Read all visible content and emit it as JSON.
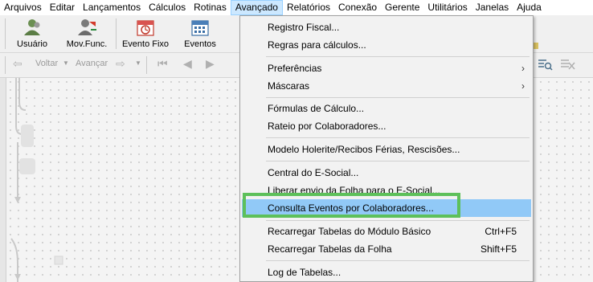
{
  "menubar": {
    "items": [
      "Arquivos",
      "Editar",
      "Lançamentos",
      "Cálculos",
      "Rotinas",
      "Avançado",
      "Relatórios",
      "Conexão",
      "Gerente",
      "Utilitários",
      "Janelas",
      "Ajuda"
    ]
  },
  "toolbar": {
    "buttons": [
      {
        "label": "Usuário",
        "icon": "users-icon"
      },
      {
        "label": "Mov.Func.",
        "icon": "employee-movement-icon"
      },
      {
        "label": "Evento Fixo",
        "icon": "fixed-event-calendar-icon"
      },
      {
        "label": "Eventos",
        "icon": "events-calendar-icon"
      }
    ]
  },
  "navbar": {
    "back_label": "Voltar",
    "forward_label": "Avançar"
  },
  "dropdown": {
    "items": [
      {
        "label": "Registro Fiscal..."
      },
      {
        "label": "Regras para cálculos..."
      },
      {
        "label": "Preferências",
        "submenu": true
      },
      {
        "label": "Máscaras",
        "submenu": true
      },
      {
        "label": "Fórmulas de Cálculo..."
      },
      {
        "label": "Rateio por Colaboradores..."
      },
      {
        "label": "Modelo Holerite/Recibos Férias, Rescisões..."
      },
      {
        "label": "Central do E-Social..."
      },
      {
        "label": "Liberar envio da Folha para o E-Social..."
      },
      {
        "label": "Consulta Eventos por Colaboradores...",
        "highlighted": true
      },
      {
        "label": "Recarregar Tabelas do Módulo Básico",
        "shortcut": "Ctrl+F5"
      },
      {
        "label": "Recarregar Tabelas da Folha",
        "shortcut": "Shift+F5"
      },
      {
        "label": "Log de Tabelas..."
      }
    ]
  },
  "colors": {
    "highlight_item": "#91c9f7",
    "callout_border": "#5dc05a",
    "active_menu": "#cce8ff"
  }
}
